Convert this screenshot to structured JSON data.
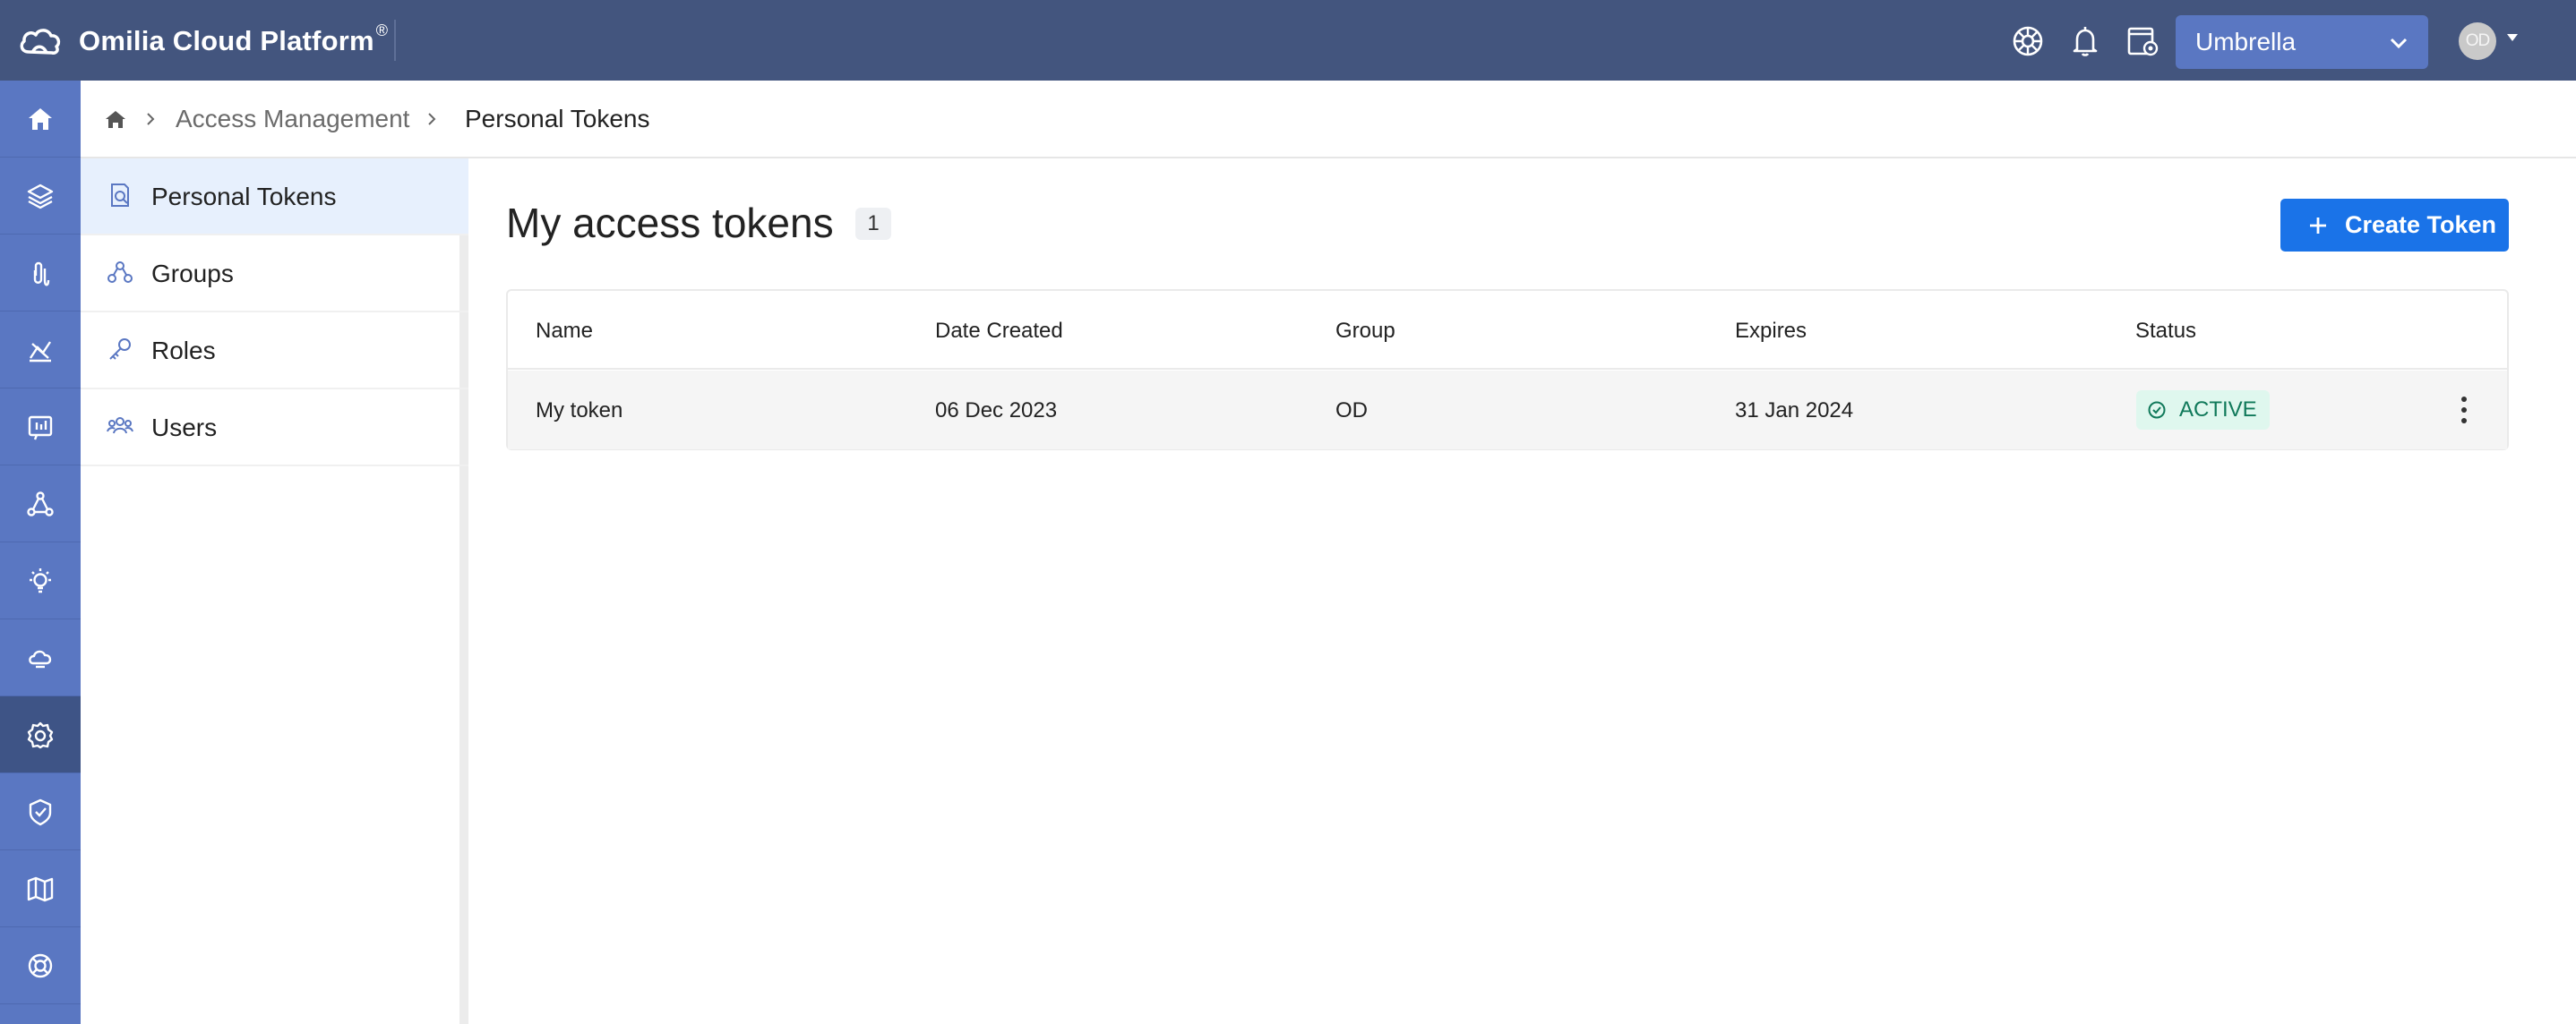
{
  "topbar": {
    "brand": "Omilia Cloud Platform",
    "brand_mark": "®",
    "icons": [
      "help-wheel-icon",
      "bell-icon",
      "settings-page-icon"
    ],
    "org": "Umbrella",
    "avatar_initials": "OD"
  },
  "rail": {
    "items": [
      "home-icon",
      "layers-icon",
      "paperclip-icon",
      "analytics-icon",
      "reports-icon",
      "network-icon",
      "ideas-icon",
      "cloud-icon",
      "settings-icon",
      "shield-check-icon",
      "map-icon",
      "support-icon"
    ],
    "active_index": 8
  },
  "breadcrumb": {
    "items": [
      "Access Management",
      "Personal Tokens"
    ]
  },
  "subnav": {
    "items": [
      {
        "label": "Personal Tokens",
        "icon": "token-search-icon",
        "active": true
      },
      {
        "label": "Groups",
        "icon": "groups-icon",
        "active": false
      },
      {
        "label": "Roles",
        "icon": "key-icon",
        "active": false
      },
      {
        "label": "Users",
        "icon": "users-icon",
        "active": false
      }
    ]
  },
  "main": {
    "title": "My access tokens",
    "count": "1",
    "create_button": "Create Token"
  },
  "table": {
    "columns": [
      "Name",
      "Date Created",
      "Group",
      "Expires",
      "Status"
    ],
    "rows": [
      {
        "name": "My token",
        "date_created": "06 Dec 2023",
        "group": "OD",
        "expires": "31 Jan 2024",
        "status": "ACTIVE"
      }
    ]
  },
  "colors": {
    "topbar": "#43557e",
    "rail": "#5a77c2",
    "primary": "#1a73e8",
    "status_active": "#10795a"
  }
}
